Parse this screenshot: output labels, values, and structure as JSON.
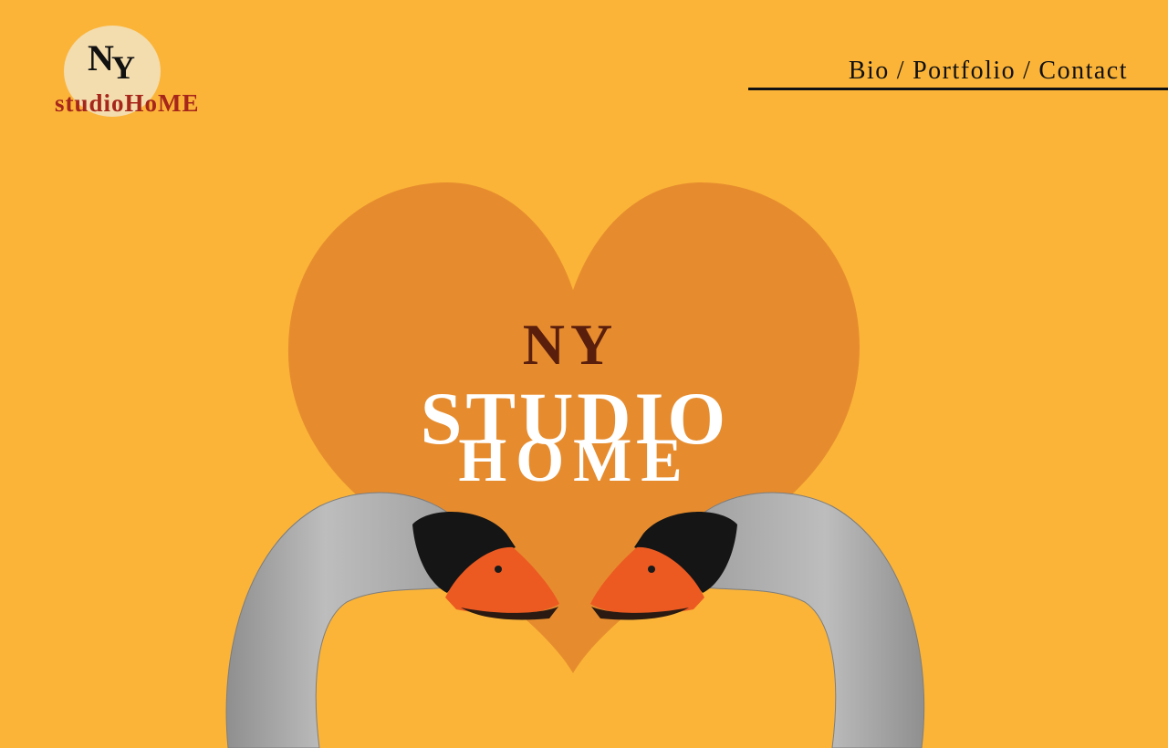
{
  "logo": {
    "ny_n": "N",
    "ny_y": "Y",
    "text": "studioHoME"
  },
  "nav": {
    "items": [
      {
        "label": "Bio"
      },
      {
        "label": "Portfolio"
      },
      {
        "label": "Contact"
      }
    ],
    "separator": "/"
  },
  "hero": {
    "line1": "NY",
    "line2": "STUDIO",
    "line3": "HOME"
  },
  "colors": {
    "background": "#fbb438",
    "heart": "#e68c2e",
    "logo_red": "#a6261c",
    "hero_brown": "#5a1e0c"
  }
}
